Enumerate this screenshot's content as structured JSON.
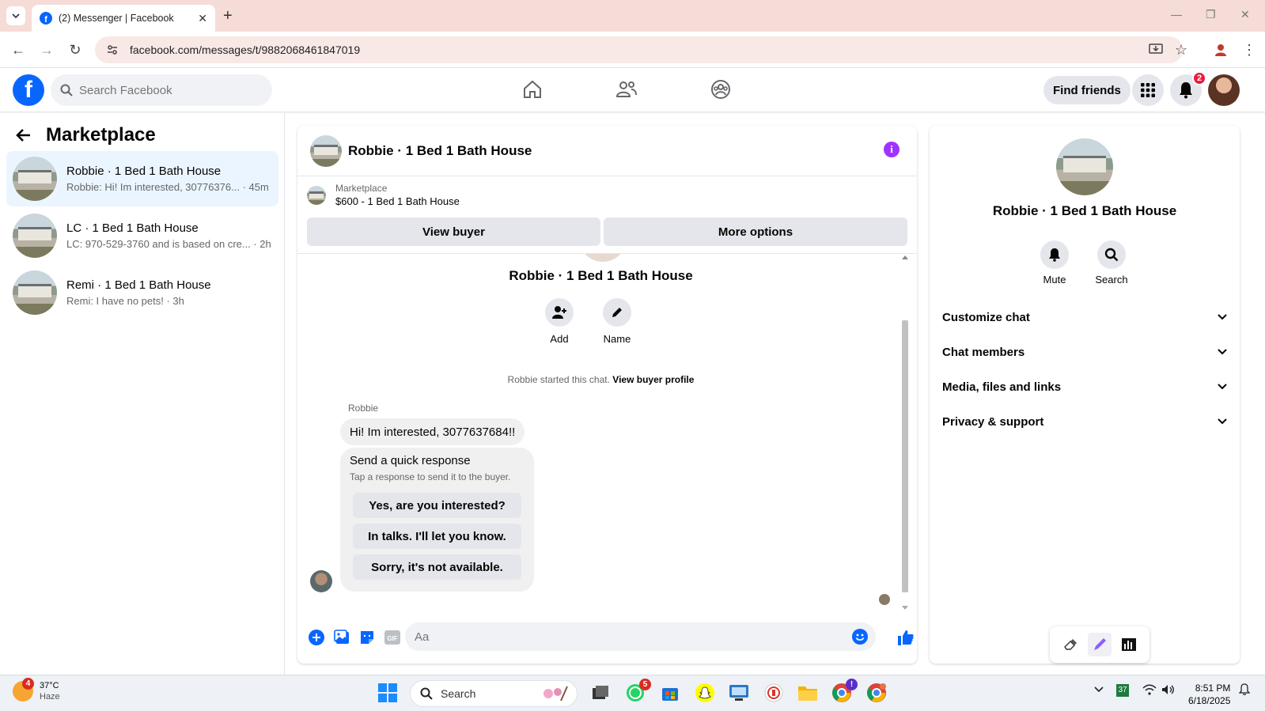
{
  "browser": {
    "tab_title": "(2) Messenger | Facebook",
    "url": "facebook.com/messages/t/9882068461847019"
  },
  "header": {
    "search_placeholder": "Search Facebook",
    "find_friends": "Find friends",
    "notifications_count": "2"
  },
  "sidebar": {
    "title": "Marketplace",
    "chats": [
      {
        "name": "Robbie · 1 Bed 1 Bath House",
        "preview": "Robbie: Hi! Im interested, 30776376... · 45m"
      },
      {
        "name": "LC · 1 Bed 1 Bath House",
        "preview": "LC: 970-529-3760 and is based on cre... · 2h"
      },
      {
        "name": "Remi · 1 Bed 1 Bath House",
        "preview": "Remi: I have no pets! · 3h"
      }
    ]
  },
  "conversation": {
    "title": "Robbie · 1 Bed 1 Bath House",
    "marketplace_label": "Marketplace",
    "listing": "$600 - 1 Bed 1 Bath House",
    "view_buyer": "View buyer",
    "more_options": "More options",
    "center_name": "Robbie · 1 Bed 1 Bath House",
    "add_label": "Add",
    "name_label": "Name",
    "started_text": "Robbie started this chat.",
    "view_buyer_profile": "View buyer profile",
    "sender": "Robbie",
    "message": "Hi! Im interested,  3077637684!!",
    "quick_title": "Send a quick response",
    "quick_sub": "Tap a response to send it to the buyer.",
    "quick_responses": [
      "Yes, are you interested?",
      "In talks. I'll let you know.",
      "Sorry, it's not available."
    ],
    "composer_placeholder": "Aa"
  },
  "right_panel": {
    "name": "Robbie · 1 Bed 1 Bath House",
    "mute": "Mute",
    "search": "Search",
    "sections": [
      "Customize chat",
      "Chat members",
      "Media, files and links",
      "Privacy & support"
    ]
  },
  "taskbar": {
    "weather_badge": "4",
    "temp": "37°C",
    "condition": "Haze",
    "search": "Search",
    "whatsapp_badge": "5",
    "chrome_badge": "!",
    "sheets_num": "37",
    "time": "8:51 PM",
    "date": "6/18/2025"
  },
  "colors": {
    "fb_blue": "#0866ff",
    "active_chat": "#ebf5ff",
    "info_purple": "#a033ff",
    "badge_red": "#e41e3f"
  }
}
